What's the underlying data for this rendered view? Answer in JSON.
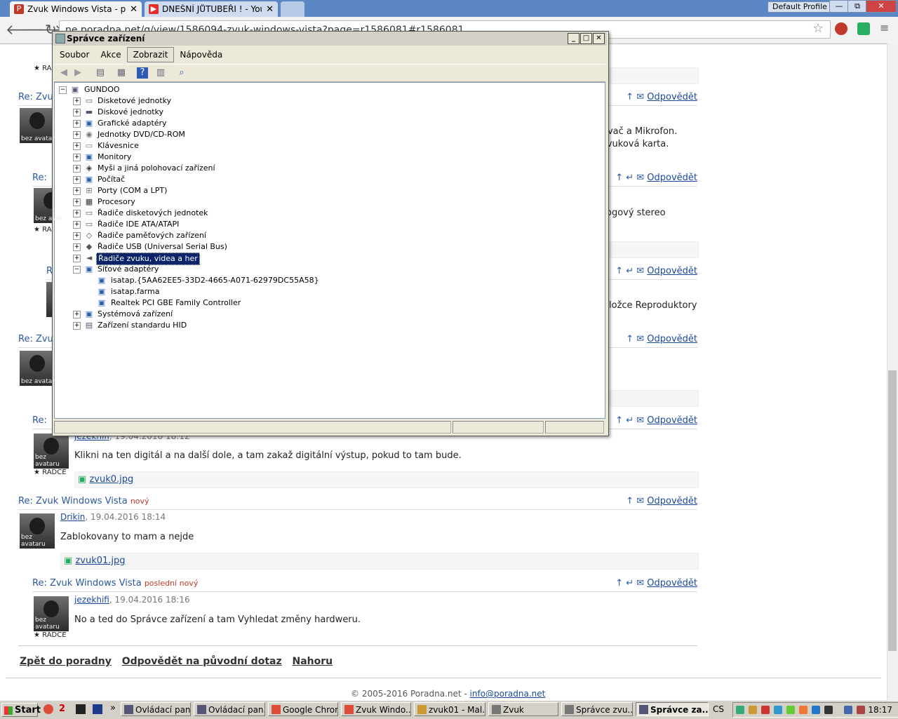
{
  "browser": {
    "tabs": [
      {
        "title": "Zvuk Windows Vista - poradn",
        "fav_color": "#c0392b",
        "fav": "P"
      },
      {
        "title": "DNEŠNÍ JŮTUBEŘI ! - YouTu",
        "fav_color": "#e52d27",
        "fav": "▶"
      }
    ],
    "profile": "Default Profile",
    "url": "ne.poradna.net/q/view/1586094-zvuk-windows-vista?page=r1586081#r1586081",
    "win_min": "—",
    "win_max": "⧉",
    "win_close": "✕"
  },
  "posts": {
    "p1": {
      "title": "Re: Zvu",
      "reply": "Odpovědět",
      "text1": "ovač a Mikrofon.",
      "text2": "zvuková karta.",
      "avatar": "bez avatar"
    },
    "p2": {
      "title": "Re:",
      "reply": "Odpovědět",
      "text": "ogový stereo",
      "avatar": "bez avat",
      "badge": "RA"
    },
    "p3": {
      "title": "R",
      "reply": "Odpovědět",
      "text": "ložce Reproduktory"
    },
    "p4": {
      "title": "Re: Zvu",
      "reply": "Odpovědět",
      "avatar": "bez avatar"
    },
    "p5": {
      "title": "Re:",
      "reply": "Odpovědět",
      "author": "jezekhifi",
      "date": ", 19.04.2016 18:12",
      "text": "Klikni na ten digitál a na další dole, a tam zakaž digitální výstup, pokud to tam bude.",
      "attachment": "zvuk0.jpg",
      "avatar": "bez avataru",
      "badge": "RÁDCE"
    },
    "p6": {
      "title": "Re: Zvuk Windows Vista",
      "new": "nový",
      "reply": "Odpovědět",
      "author": "Drikin",
      "date": ", 19.04.2016 18:14",
      "text": "Zablokovany to mam a nejde",
      "attachment": "zvuk01.jpg",
      "avatar": "bez avataru"
    },
    "p7": {
      "title": "Re: Zvuk Windows Vista",
      "new": "poslední nový",
      "reply": "Odpovědět",
      "author": "jezekhifi",
      "date": ", 19.04.2016 18:16",
      "text": "No a ted do Správce zařízení a tam Vyhledat změny hardweru.",
      "avatar": "bez avataru",
      "badge": "RÁDCE"
    }
  },
  "footer": {
    "back": "Zpět do poradny",
    "reply_orig": "Odpovědět na původní dotaz",
    "top": "Nahoru",
    "copyright": "© 2005-2016 Poradna.net - ",
    "email": "info@poradna.net"
  },
  "device_manager": {
    "title": "Správce zařízení",
    "menu": [
      "Soubor",
      "Akce",
      "Zobrazit",
      "Nápověda"
    ],
    "root": "GUNDOO",
    "nodes": [
      "Disketové jednotky",
      "Diskové jednotky",
      "Grafické adaptéry",
      "Jednotky DVD/CD-ROM",
      "Klávesnice",
      "Monitory",
      "Myši a jiná polohovací zařízení",
      "Počítač",
      "Porty (COM a LPT)",
      "Procesory",
      "Řadiče disketových jednotek",
      "Řadiče IDE ATA/ATAPI",
      "Řadiče paměťových zařízení",
      "Řadiče USB (Universal Serial Bus)",
      "Řadiče zvuku, videa a her",
      "Síťové adaptéry",
      "Systémová zařízení",
      "Zařízení standardu HID"
    ],
    "net_children": [
      "isatap.{5AA62EE5-33D2-4665-A071-62979DC55A58}",
      "isatap.farma",
      "Realtek PCI GBE Family Controller"
    ],
    "selected": "Řadiče zvuku, videa a her"
  },
  "taskbar": {
    "start": "Start",
    "quick_badge": "2",
    "more": "»",
    "buttons": [
      "Ovládací pan...",
      "Ovládací pan...",
      "Google Chrome",
      "Zvuk Windo...",
      "zvuk01 - Mal...",
      "Zvuk",
      "Správce zvu...",
      "Správce za..."
    ],
    "lang": "CS",
    "clock": "18:17"
  }
}
